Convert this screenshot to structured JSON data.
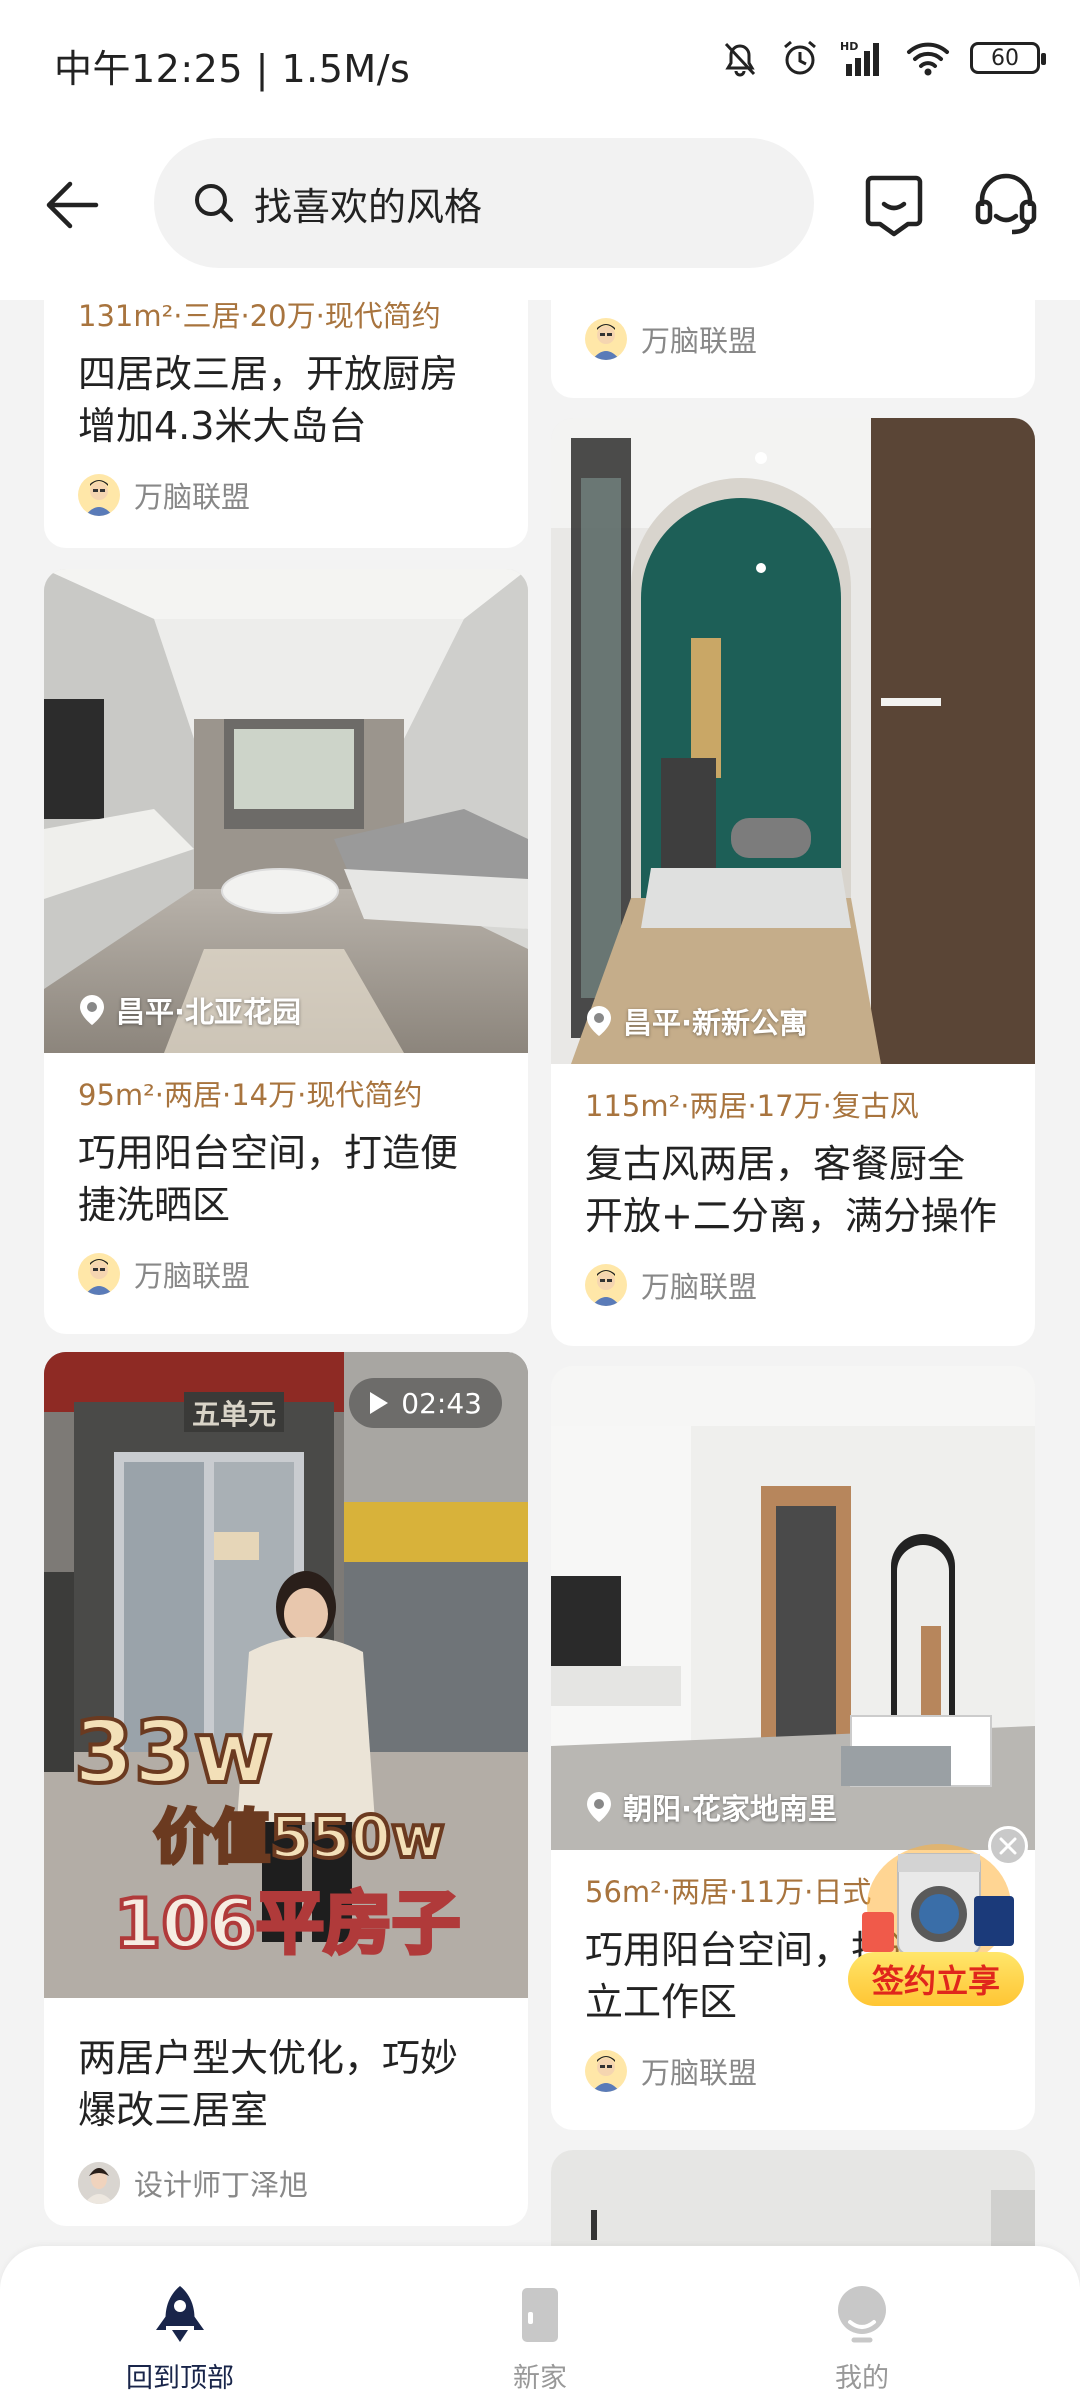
{
  "status_bar": {
    "time": "中午12:25 | 1.5M/s",
    "battery": "60"
  },
  "header": {
    "search_placeholder": "找喜欢的风格"
  },
  "feed": {
    "left": [
      {
        "tags": "131m²·三居·20万·现代简约",
        "title": "四居改三居，开放厨房增加4.3米大岛台",
        "author": "万脑联盟"
      },
      {
        "location": "昌平·北亚花园",
        "tags": "95m²·两居·14万·现代简约",
        "title": "巧用阳台空间，打造便捷洗晒区",
        "author": "万脑联盟"
      },
      {
        "duration": "02:43",
        "overlay_lines": [
          "33w",
          "价值550w",
          "106平房子"
        ],
        "sign_text": "五单元",
        "title": "两居户型大优化，巧妙爆改三居室",
        "author": "设计师丁泽旭"
      }
    ],
    "right": [
      {
        "author": "万脑联盟"
      },
      {
        "location": "昌平·新新公寓",
        "tags": "115m²·两居·17万·复古风",
        "title": "复古风两居，客餐厨全开放+二分离，满分操作",
        "author": "万脑联盟"
      },
      {
        "location": "朝阳·花家地南里",
        "tags": "56m²·两居·11万·日式",
        "title": "巧用阳台空间，打造独立工作区",
        "author": "万脑联盟"
      }
    ]
  },
  "promo": {
    "label": "签约立享"
  },
  "bottom_nav": [
    {
      "label": "回到顶部",
      "active": true
    },
    {
      "label": "新家",
      "active": false
    },
    {
      "label": "我的",
      "active": false
    }
  ],
  "colors": {
    "tag": "#a8743e",
    "nav_active": "#19254a",
    "promo_text": "#e0261c"
  }
}
